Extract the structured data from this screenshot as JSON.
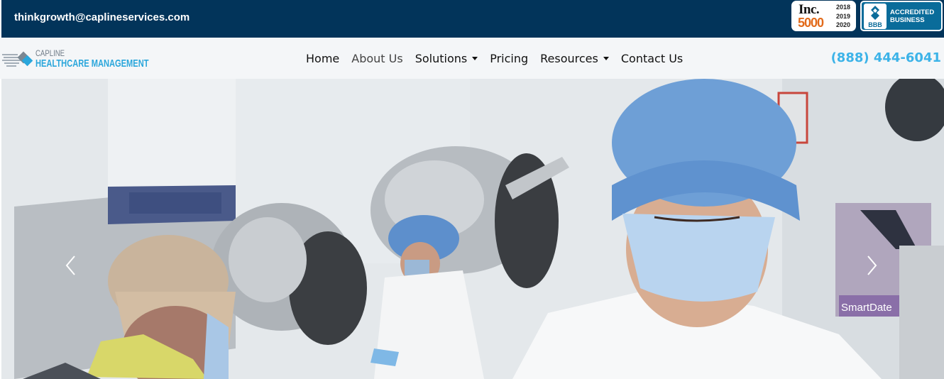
{
  "topbar": {
    "email": "thinkgrowth@caplineservices.com",
    "inc_badge": {
      "logo": "Inc.",
      "number": "5000",
      "years": [
        "2018",
        "2019",
        "2020"
      ]
    },
    "bbb_badge": {
      "seal_text": "BBB",
      "line1": "ACCREDITED",
      "line2": "BUSINESS"
    }
  },
  "header": {
    "logo": {
      "line1": "CAPLINE",
      "line2": "HEALTHCARE MANAGEMENT"
    },
    "nav": [
      {
        "label": "Home",
        "dropdown": false
      },
      {
        "label": "About Us",
        "dropdown": false
      },
      {
        "label": "Solutions",
        "dropdown": true
      },
      {
        "label": "Pricing",
        "dropdown": false
      },
      {
        "label": "Resources",
        "dropdown": true
      },
      {
        "label": "Contact Us",
        "dropdown": false
      }
    ],
    "phone": "(888) 444-6041"
  },
  "hero": {
    "prev_icon": "chevron-left-icon",
    "next_icon": "chevron-right-icon",
    "machine_label": "SmartDate"
  },
  "colors": {
    "topbar_bg": "#02345a",
    "navbar_bg": "#f4f6f8",
    "accent": "#3cb3e8",
    "logo_blue": "#2aa6db"
  }
}
